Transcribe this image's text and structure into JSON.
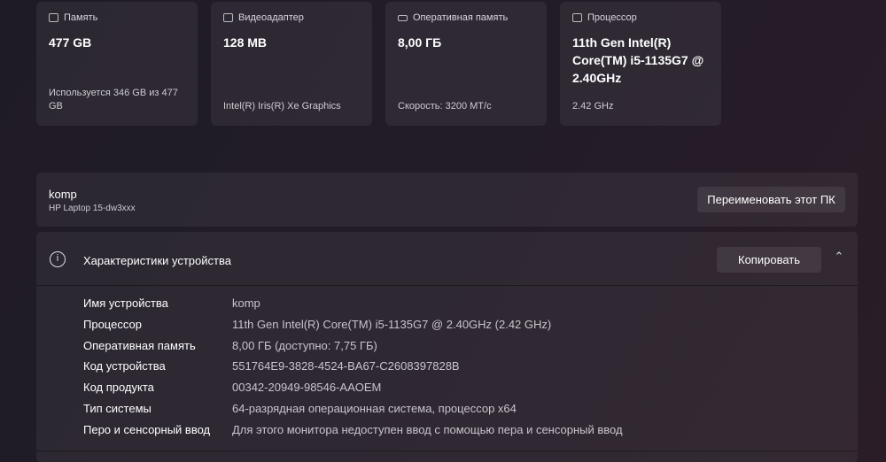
{
  "cards": [
    {
      "title": "Память",
      "value": "477 GB",
      "sub": "Используется 346 GB из 477 GB",
      "icon": "storage-icon"
    },
    {
      "title": "Видеоадаптер",
      "value": "128 MB",
      "sub": "Intel(R) Iris(R) Xe Graphics",
      "icon": "gpu-icon"
    },
    {
      "title": "Оперативная память",
      "value": "8,00 ГБ",
      "sub": "Скорость: 3200 МТ/с",
      "icon": "ram-icon"
    },
    {
      "title": "Процессор",
      "value": "11th Gen Intel(R) Core(TM) i5-1135G7 @ 2.40GHz",
      "sub": "2.42 GHz",
      "icon": "cpu-icon"
    }
  ],
  "device": {
    "name": "komp",
    "model": "HP Laptop 15-dw3xxx",
    "rename_label": "Переименовать этот ПК"
  },
  "specs": {
    "title": "Характеристики устройства",
    "copy_label": "Копировать",
    "rows": [
      {
        "k": "Имя устройства",
        "v": "komp"
      },
      {
        "k": "Процессор",
        "v": "11th Gen Intel(R) Core(TM) i5-1135G7 @ 2.40GHz (2.42 GHz)"
      },
      {
        "k": "Оперативная память",
        "v": "8,00 ГБ (доступно: 7,75 ГБ)"
      },
      {
        "k": "Код устройства",
        "v": "551764E9-3828-4524-BA67-C2608397828B"
      },
      {
        "k": "Код продукта",
        "v": "00342-20949-98546-AAOEM"
      },
      {
        "k": "Тип системы",
        "v": "64-разрядная операционная система, процессор x64"
      },
      {
        "k": "Перо и сенсорный ввод",
        "v": "Для этого монитора недоступен ввод с помощью пера и сенсорный ввод"
      }
    ]
  }
}
